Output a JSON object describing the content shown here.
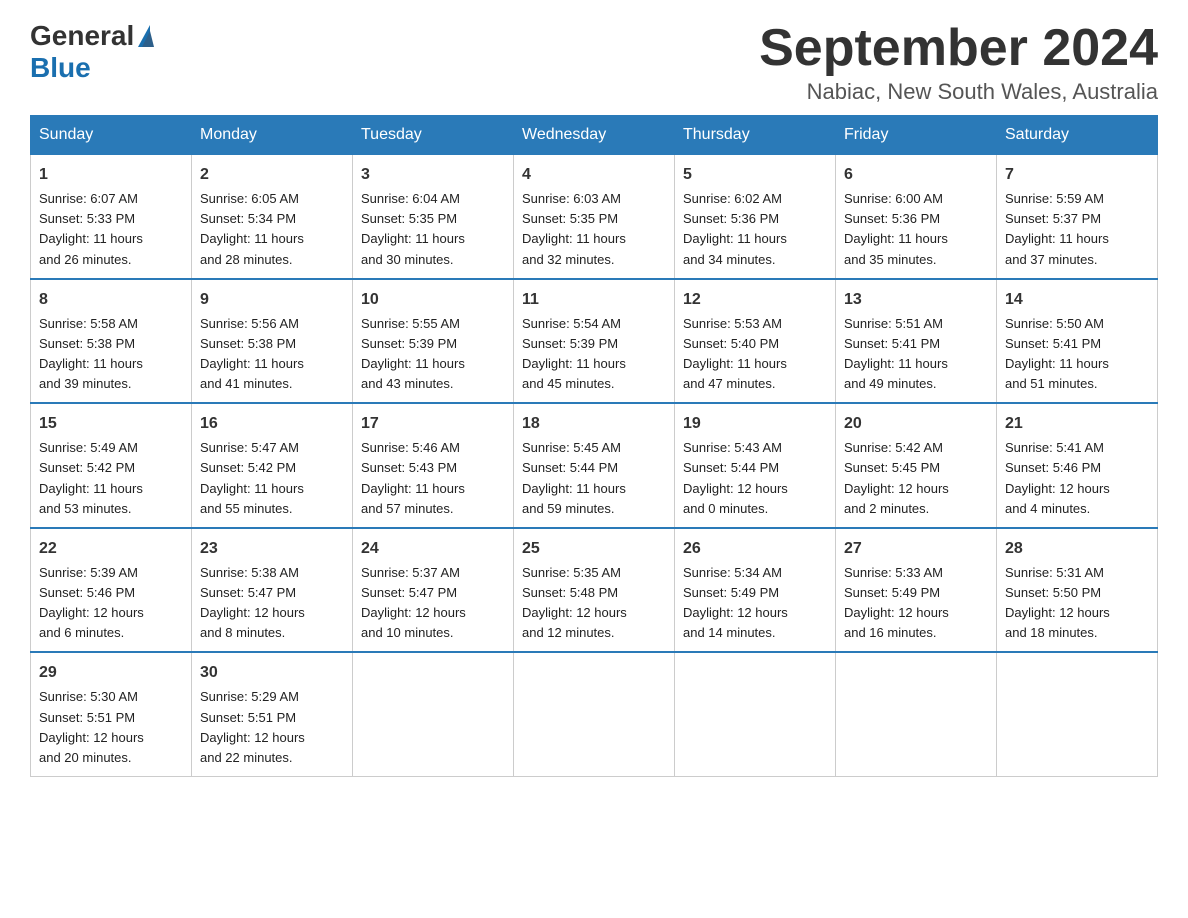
{
  "logo": {
    "text_general": "General",
    "text_blue": "Blue",
    "aria": "GeneralBlue logo"
  },
  "title": {
    "month_year": "September 2024",
    "location": "Nabiac, New South Wales, Australia"
  },
  "weekdays": [
    "Sunday",
    "Monday",
    "Tuesday",
    "Wednesday",
    "Thursday",
    "Friday",
    "Saturday"
  ],
  "weeks": [
    [
      {
        "day": "1",
        "sunrise": "6:07 AM",
        "sunset": "5:33 PM",
        "daylight": "11 hours and 26 minutes."
      },
      {
        "day": "2",
        "sunrise": "6:05 AM",
        "sunset": "5:34 PM",
        "daylight": "11 hours and 28 minutes."
      },
      {
        "day": "3",
        "sunrise": "6:04 AM",
        "sunset": "5:35 PM",
        "daylight": "11 hours and 30 minutes."
      },
      {
        "day": "4",
        "sunrise": "6:03 AM",
        "sunset": "5:35 PM",
        "daylight": "11 hours and 32 minutes."
      },
      {
        "day": "5",
        "sunrise": "6:02 AM",
        "sunset": "5:36 PM",
        "daylight": "11 hours and 34 minutes."
      },
      {
        "day": "6",
        "sunrise": "6:00 AM",
        "sunset": "5:36 PM",
        "daylight": "11 hours and 35 minutes."
      },
      {
        "day": "7",
        "sunrise": "5:59 AM",
        "sunset": "5:37 PM",
        "daylight": "11 hours and 37 minutes."
      }
    ],
    [
      {
        "day": "8",
        "sunrise": "5:58 AM",
        "sunset": "5:38 PM",
        "daylight": "11 hours and 39 minutes."
      },
      {
        "day": "9",
        "sunrise": "5:56 AM",
        "sunset": "5:38 PM",
        "daylight": "11 hours and 41 minutes."
      },
      {
        "day": "10",
        "sunrise": "5:55 AM",
        "sunset": "5:39 PM",
        "daylight": "11 hours and 43 minutes."
      },
      {
        "day": "11",
        "sunrise": "5:54 AM",
        "sunset": "5:39 PM",
        "daylight": "11 hours and 45 minutes."
      },
      {
        "day": "12",
        "sunrise": "5:53 AM",
        "sunset": "5:40 PM",
        "daylight": "11 hours and 47 minutes."
      },
      {
        "day": "13",
        "sunrise": "5:51 AM",
        "sunset": "5:41 PM",
        "daylight": "11 hours and 49 minutes."
      },
      {
        "day": "14",
        "sunrise": "5:50 AM",
        "sunset": "5:41 PM",
        "daylight": "11 hours and 51 minutes."
      }
    ],
    [
      {
        "day": "15",
        "sunrise": "5:49 AM",
        "sunset": "5:42 PM",
        "daylight": "11 hours and 53 minutes."
      },
      {
        "day": "16",
        "sunrise": "5:47 AM",
        "sunset": "5:42 PM",
        "daylight": "11 hours and 55 minutes."
      },
      {
        "day": "17",
        "sunrise": "5:46 AM",
        "sunset": "5:43 PM",
        "daylight": "11 hours and 57 minutes."
      },
      {
        "day": "18",
        "sunrise": "5:45 AM",
        "sunset": "5:44 PM",
        "daylight": "11 hours and 59 minutes."
      },
      {
        "day": "19",
        "sunrise": "5:43 AM",
        "sunset": "5:44 PM",
        "daylight": "12 hours and 0 minutes."
      },
      {
        "day": "20",
        "sunrise": "5:42 AM",
        "sunset": "5:45 PM",
        "daylight": "12 hours and 2 minutes."
      },
      {
        "day": "21",
        "sunrise": "5:41 AM",
        "sunset": "5:46 PM",
        "daylight": "12 hours and 4 minutes."
      }
    ],
    [
      {
        "day": "22",
        "sunrise": "5:39 AM",
        "sunset": "5:46 PM",
        "daylight": "12 hours and 6 minutes."
      },
      {
        "day": "23",
        "sunrise": "5:38 AM",
        "sunset": "5:47 PM",
        "daylight": "12 hours and 8 minutes."
      },
      {
        "day": "24",
        "sunrise": "5:37 AM",
        "sunset": "5:47 PM",
        "daylight": "12 hours and 10 minutes."
      },
      {
        "day": "25",
        "sunrise": "5:35 AM",
        "sunset": "5:48 PM",
        "daylight": "12 hours and 12 minutes."
      },
      {
        "day": "26",
        "sunrise": "5:34 AM",
        "sunset": "5:49 PM",
        "daylight": "12 hours and 14 minutes."
      },
      {
        "day": "27",
        "sunrise": "5:33 AM",
        "sunset": "5:49 PM",
        "daylight": "12 hours and 16 minutes."
      },
      {
        "day": "28",
        "sunrise": "5:31 AM",
        "sunset": "5:50 PM",
        "daylight": "12 hours and 18 minutes."
      }
    ],
    [
      {
        "day": "29",
        "sunrise": "5:30 AM",
        "sunset": "5:51 PM",
        "daylight": "12 hours and 20 minutes."
      },
      {
        "day": "30",
        "sunrise": "5:29 AM",
        "sunset": "5:51 PM",
        "daylight": "12 hours and 22 minutes."
      },
      null,
      null,
      null,
      null,
      null
    ]
  ],
  "labels": {
    "sunrise": "Sunrise:",
    "sunset": "Sunset:",
    "daylight": "Daylight:"
  }
}
